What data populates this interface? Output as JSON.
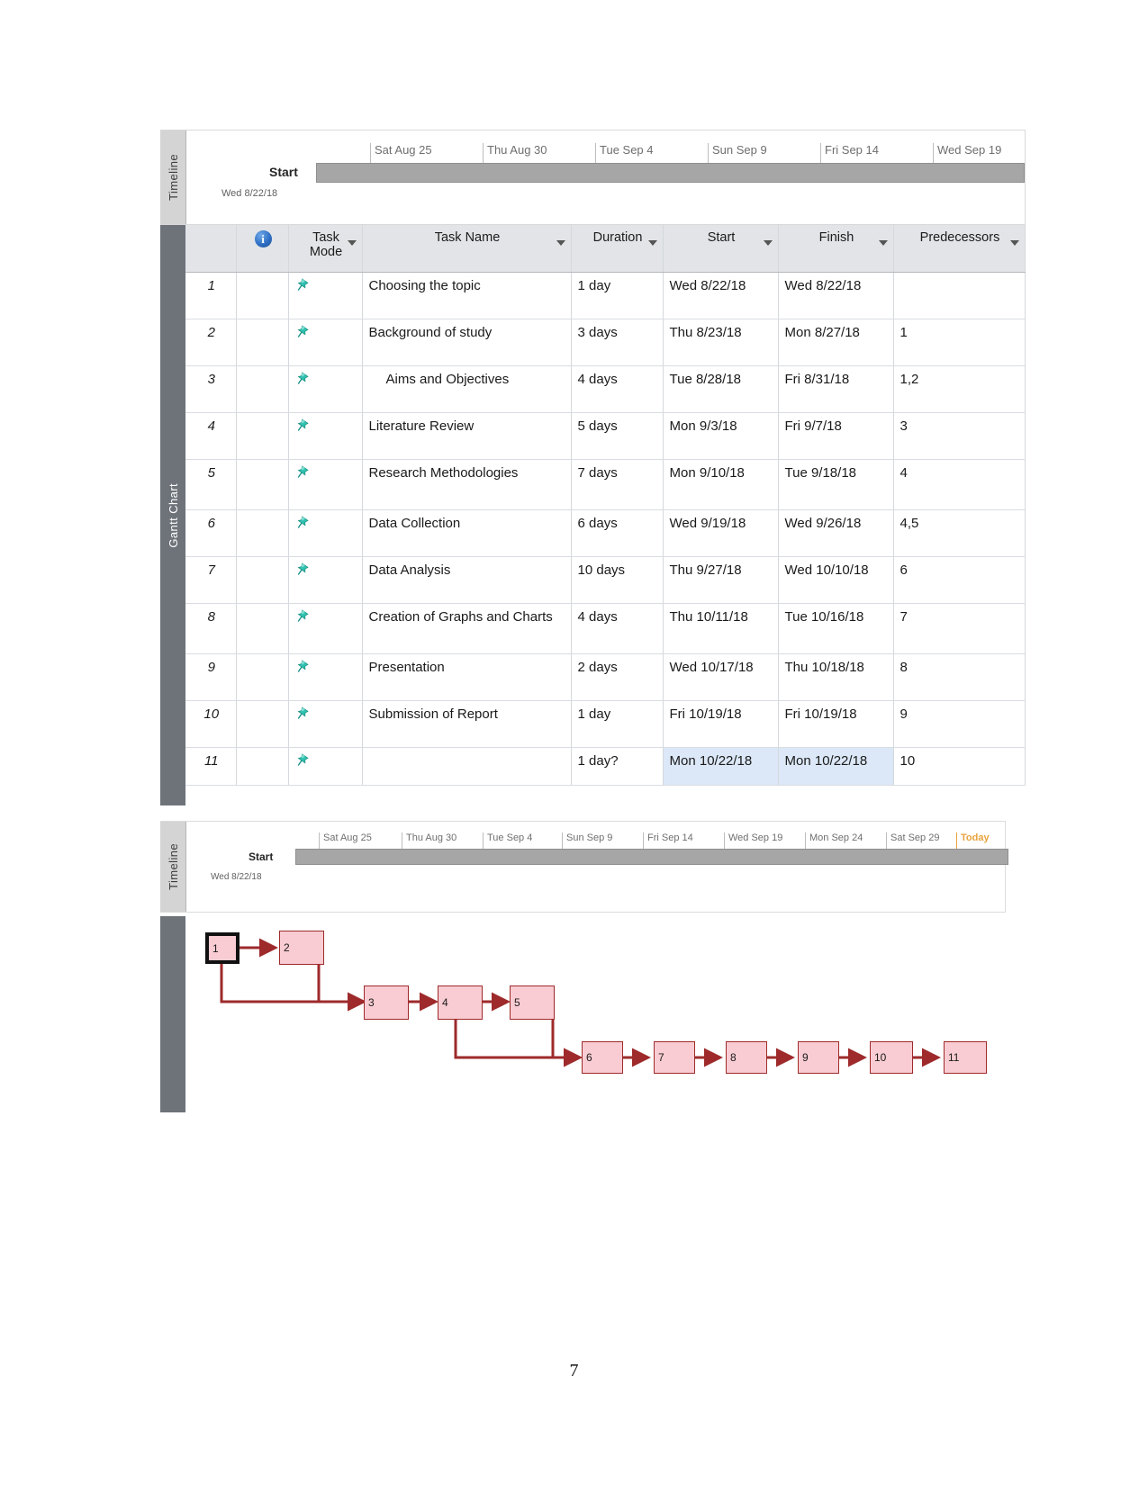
{
  "document": {
    "page_number": "7"
  },
  "timeline_top": {
    "side_label": "Timeline",
    "start_label": "Start",
    "start_date": "Wed 8/22/18",
    "ticks": [
      "Sat Aug 25",
      "Thu Aug 30",
      "Tue Sep 4",
      "Sun Sep 9",
      "Fri Sep 14",
      "Wed Sep 19"
    ]
  },
  "gantt": {
    "side_label": "Gantt Chart",
    "columns": [
      {
        "key": "id",
        "label": "",
        "arrow": false,
        "highlight": false
      },
      {
        "key": "info",
        "label": "",
        "arrow": false,
        "highlight": false,
        "icon": "info-icon"
      },
      {
        "key": "mode",
        "label": "Task Mode",
        "arrow": true,
        "highlight": false
      },
      {
        "key": "name",
        "label": "Task Name",
        "arrow": true,
        "highlight": false
      },
      {
        "key": "duration",
        "label": "Duration",
        "arrow": true,
        "highlight": false
      },
      {
        "key": "start",
        "label": "Start",
        "arrow": true,
        "highlight": false
      },
      {
        "key": "finish",
        "label": "Finish",
        "arrow": true,
        "highlight": false
      },
      {
        "key": "pred",
        "label": "Predecessors",
        "arrow": true,
        "highlight": true
      }
    ],
    "rows": [
      {
        "id": "1",
        "name": "Choosing the topic",
        "duration": "1 day",
        "start": "Wed 8/22/18",
        "finish": "Wed 8/22/18",
        "pred": "",
        "indent": false,
        "selected": false,
        "tall": false
      },
      {
        "id": "2",
        "name": "Background of study",
        "duration": "3 days",
        "start": "Thu 8/23/18",
        "finish": "Mon 8/27/18",
        "pred": "1",
        "indent": false,
        "selected": false,
        "tall": false
      },
      {
        "id": "3",
        "name": "Aims and Objectives",
        "duration": "4 days",
        "start": "Tue 8/28/18",
        "finish": "Fri 8/31/18",
        "pred": "1,2",
        "indent": true,
        "selected": false,
        "tall": false
      },
      {
        "id": "4",
        "name": "Literature Review",
        "duration": "5 days",
        "start": "Mon 9/3/18",
        "finish": "Fri 9/7/18",
        "pred": "3",
        "indent": false,
        "selected": false,
        "tall": false
      },
      {
        "id": "5",
        "name": "Research Methodologies",
        "duration": "7 days",
        "start": "Mon 9/10/18",
        "finish": "Tue 9/18/18",
        "pred": "4",
        "indent": false,
        "selected": false,
        "tall": true
      },
      {
        "id": "6",
        "name": "Data Collection",
        "duration": "6 days",
        "start": "Wed 9/19/18",
        "finish": "Wed 9/26/18",
        "pred": "4,5",
        "indent": false,
        "selected": false,
        "tall": false
      },
      {
        "id": "7",
        "name": "Data Analysis",
        "duration": "10 days",
        "start": "Thu 9/27/18",
        "finish": "Wed 10/10/18",
        "pred": "6",
        "indent": false,
        "selected": false,
        "tall": false
      },
      {
        "id": "8",
        "name": "Creation of Graphs and Charts",
        "duration": "4 days",
        "start": "Thu 10/11/18",
        "finish": "Tue 10/16/18",
        "pred": "7",
        "indent": false,
        "selected": false,
        "tall": true
      },
      {
        "id": "9",
        "name": "Presentation",
        "duration": "2 days",
        "start": "Wed 10/17/18",
        "finish": "Thu 10/18/18",
        "pred": "8",
        "indent": false,
        "selected": false,
        "tall": false
      },
      {
        "id": "10",
        "name": "Submission of Report",
        "duration": "1 day",
        "start": "Fri 10/19/18",
        "finish": "Fri 10/19/18",
        "pred": "9",
        "indent": false,
        "selected": false,
        "tall": false
      },
      {
        "id": "11",
        "name": "",
        "duration": "1 day?",
        "start": "Mon 10/22/18",
        "finish": "Mon 10/22/18",
        "pred": "10",
        "indent": false,
        "selected": true,
        "tall": false
      }
    ]
  },
  "timeline_bottom": {
    "side_label": "Timeline",
    "start_label": "Start",
    "start_date": "Wed 8/22/18",
    "ticks": [
      "Sat Aug 25",
      "Thu Aug 30",
      "Tue Sep 4",
      "Sun Sep 9",
      "Fri Sep 14",
      "Wed Sep 19",
      "Mon Sep 24",
      "Sat Sep 29"
    ],
    "today_label": "Today"
  },
  "network_diagram": {
    "nodes": [
      {
        "label": "1",
        "selected": true
      },
      {
        "label": "2",
        "selected": false
      },
      {
        "label": "3",
        "selected": false
      },
      {
        "label": "4",
        "selected": false
      },
      {
        "label": "5",
        "selected": false
      },
      {
        "label": "6",
        "selected": false
      },
      {
        "label": "7",
        "selected": false
      },
      {
        "label": "8",
        "selected": false
      },
      {
        "label": "9",
        "selected": false
      },
      {
        "label": "10",
        "selected": false
      },
      {
        "label": "11",
        "selected": false
      }
    ],
    "links": [
      {
        "from": "1",
        "to": "2"
      },
      {
        "from": "1",
        "to": "3"
      },
      {
        "from": "2",
        "to": "3"
      },
      {
        "from": "3",
        "to": "4"
      },
      {
        "from": "4",
        "to": "5"
      },
      {
        "from": "4",
        "to": "6"
      },
      {
        "from": "5",
        "to": "6"
      },
      {
        "from": "6",
        "to": "7"
      },
      {
        "from": "7",
        "to": "8"
      },
      {
        "from": "8",
        "to": "9"
      },
      {
        "from": "9",
        "to": "10"
      },
      {
        "from": "10",
        "to": "11"
      }
    ]
  },
  "colors": {
    "predecessor_header": "#fbd95b",
    "selection_blue": "#dce8f7",
    "node_fill": "#f8ccd2",
    "node_border": "#9e2a2b",
    "timeline_bar": "#a6a6a6",
    "today_marker": "#e8a33d",
    "side_tab_dark": "#6e737a",
    "side_tab_light": "#d4d4d4"
  }
}
